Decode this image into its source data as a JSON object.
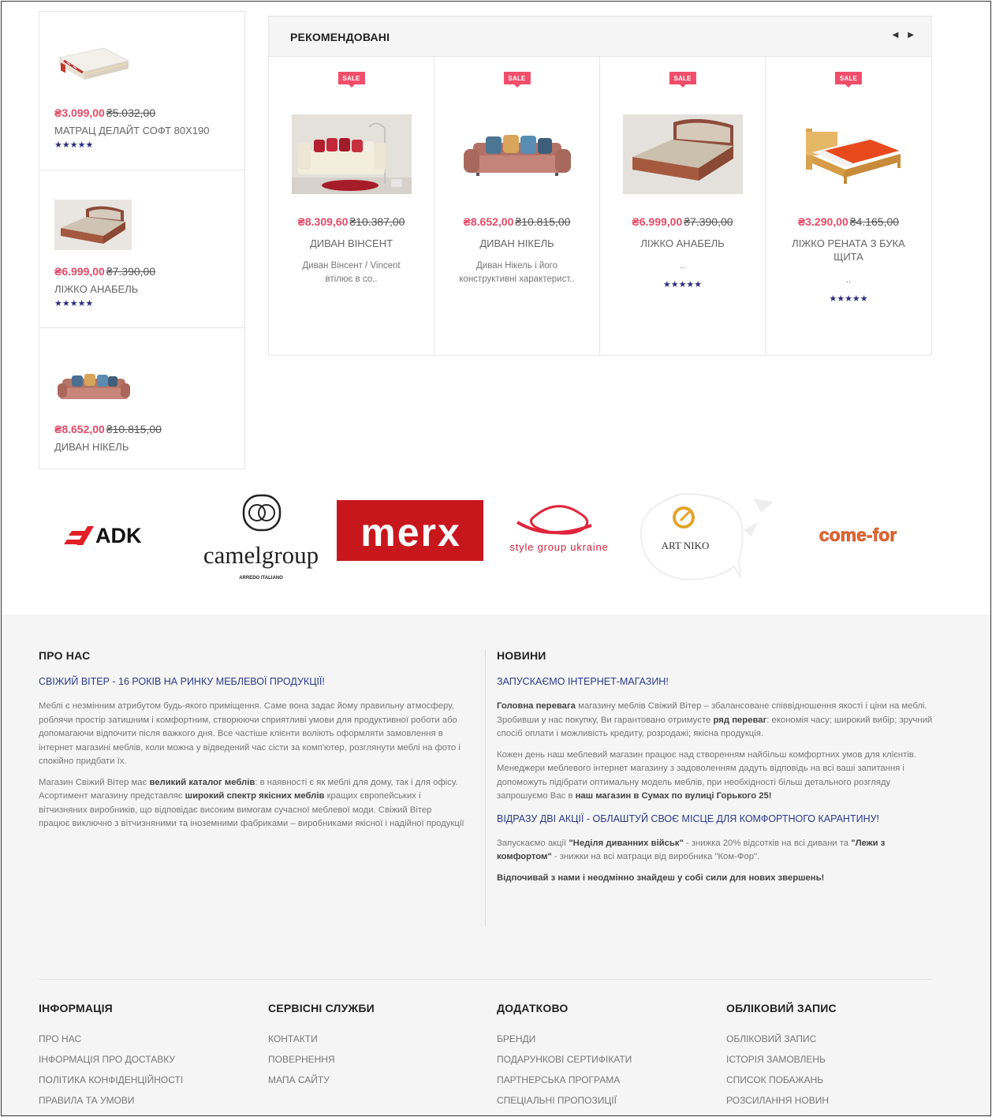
{
  "sidebar": {
    "items": [
      {
        "price_new": "₴3.099,00",
        "price_old": "₴5.032,00",
        "name": "МАТРАЦ ДЕЛАЙТ СОФТ 80Х190",
        "stars": "★★★★★"
      },
      {
        "price_new": "₴6.999,00",
        "price_old": "₴7.390,00",
        "name": "ЛІЖКО АНАБЕЛЬ",
        "stars": "★★★★★"
      },
      {
        "price_new": "₴8.652,00",
        "price_old": "₴10.815,00",
        "name": "ДИВАН НІКЕЛЬ"
      }
    ]
  },
  "recommended": {
    "title": "РЕКОМЕНДОВАНІ",
    "prev_icon": "◀",
    "next_icon": "▶",
    "products": [
      {
        "badge": "SALE",
        "price_new": "₴8.309,60",
        "price_old": "₴10.387,00",
        "name": "ДИВАН ВІНСЕНТ",
        "desc": "Диван Вінсент / Vincent втілює в со.."
      },
      {
        "badge": "SALE",
        "price_new": "₴8.652,00",
        "price_old": "₴10.815,00",
        "name": "ДИВАН НІКЕЛЬ",
        "desc": "Диван Нікель і його конструктивні характерист.."
      },
      {
        "badge": "SALE",
        "price_new": "₴6.999,00",
        "price_old": "₴7.390,00",
        "name": "ЛІЖКО АНАБЕЛЬ",
        "desc": "..",
        "stars": "★★★★★"
      },
      {
        "badge": "SALE",
        "price_new": "₴3.290,00",
        "price_old": "₴4.165,00",
        "name": "ЛІЖКО РЕНАТА З БУКА ЩИТА",
        "desc": "..",
        "stars": "★★★★★"
      }
    ]
  },
  "brands": {
    "adk": "ADK",
    "camel": "camelgroup",
    "camel_sub": "ARREDO ITALIANO",
    "merx": "merx",
    "style": "style group ukraine",
    "artniko": "ART NIKO",
    "comefor": "come-for"
  },
  "about": {
    "title": "ПРО НАС",
    "subtitle": "СВІЖИЙ ВІТЕР - 16 РОКІВ НА РИНКУ МЕБЛЕВОЇ ПРОДУКЦІЇ!",
    "p1": "Меблі є незмінним атрибутом будь-якого приміщення. Саме вона задає йому правильну атмосферу, роблячи простір затишним і комфортним, створюючи сприятливі умови для продуктивної роботи або допомагаючи відпочити після важкого дня. Все частіше клієнти воліють оформляти замовлення в інтернет магазині меблів, коли можна у відведений час сісти за комп'ютер, розглянути меблі на фото і спокійно придбати їх.",
    "p2_a": "Магазин Свіжий Вітер має ",
    "p2_b": "великий каталог меблів",
    "p2_c": ": в наявності є як меблі для дому, так і для офісу. Асортимент магазину представляє ",
    "p2_d": "широкий спектр якісних меблів",
    "p2_e": " кращих європейських і вітчизняних виробників, що відповідає високим вимогам сучасної меблевої моди. Свіжий Вітер працює виключно з вітчизняними та іноземними фабриками – виробниками якісної і надійної продукції"
  },
  "news": {
    "title": "НОВИНИ",
    "subtitle": "ЗАПУСКАЄМО ІНТЕРНЕТ-МАГАЗИН!",
    "p1_a": "Головна перевага",
    "p1_b": " магазину меблів Свіжий Вітер – збалансоване співвідношення якості і ціни на меблі. Зробивши у нас покупку, Ви гарантовано отримуєте ",
    "p1_c": "ряд переваг",
    "p1_d": ": економія часу; широкий вибір; зручний спосіб оплати і можливість кредиту, розродажі; якісна продукція.",
    "p2_a": "Кожен день наш меблевий магазин працює над створенням найбільш комфортних умов для клієнтів. Менеджери меблевого інтернет магазину з задоволенням дадуть відповідь на всі ваші запитання і допоможуть підібрати оптимальну модель меблів, при необхідності більш детального розгляду запрошуємо Вас в ",
    "p2_b": "наш магазин в Сумах по вулиці Горького 25!",
    "subtitle2": "ВІДРАЗУ ДВІ АКЦІЇ - ОБЛАШТУЙ СВОЄ МІСЦЕ ДЛЯ КОМФОРТНОГО КАРАНТИНУ!",
    "p3_a": "Запускаємо акції ",
    "p3_b": "\"Неділя диванних військ\"",
    "p3_c": " - знижка 20% відсотків на всі дивани та ",
    "p3_d": "\"Лежи з комфортом\"",
    "p3_e": " - знижки на всі матраци від виробника \"Ком-Фор\".",
    "p4": "Відпочивай з нами і неодмінно знайдеш у собі сили для нових звершень!"
  },
  "footer_links": [
    {
      "title": "ІНФОРМАЦІЯ",
      "items": [
        "ПРО НАС",
        "ІНФОРМАЦІЯ ПРО ДОСТАВКУ",
        "ПОЛІТИКА КОНФІДЕНЦІЙНОСТІ",
        "ПРАВИЛА ТА УМОВИ"
      ]
    },
    {
      "title": "СЕРВІСНІ СЛУЖБИ",
      "items": [
        "КОНТАКТИ",
        "ПОВЕРНЕННЯ",
        "МАПА САЙТУ"
      ]
    },
    {
      "title": "ДОДАТКОВО",
      "items": [
        "БРЕНДИ",
        "ПОДАРУНКОВІ СЕРТИФІКАТИ",
        "ПАРТНЕРСЬКА ПРОГРАМА",
        "СПЕЦІАЛЬНІ ПРОПОЗИЦІЇ"
      ]
    },
    {
      "title": "ОБЛІКОВИЙ ЗАПИС",
      "items": [
        "ОБЛІКОВИЙ ЗАПИС",
        "ІСТОРІЯ ЗАМОВЛЕНЬ",
        "СПИСОК ПОБАЖАНЬ",
        "РОЗСИЛАННЯ НОВИН"
      ]
    }
  ],
  "colors": {
    "sale": "#f04e6a",
    "price_new": "#e44b67",
    "stars": "#2b2f7e",
    "link_blue": "#2b3a8a",
    "footer_bg": "#f5f5f5"
  }
}
